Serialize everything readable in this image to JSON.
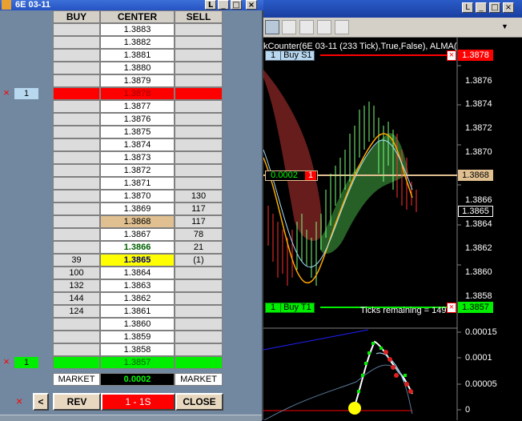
{
  "dom_window": {
    "title": "6E 03-11",
    "headers": {
      "buy": "BUY",
      "center": "CENTER",
      "sell": "SELL"
    },
    "rows": [
      {
        "buy": "",
        "price": "1.3883",
        "sell": "",
        "style": "white"
      },
      {
        "buy": "",
        "price": "1.3882",
        "sell": "",
        "style": "white"
      },
      {
        "buy": "",
        "price": "1.3881",
        "sell": "",
        "style": "white"
      },
      {
        "buy": "",
        "price": "1.3880",
        "sell": "",
        "style": "white"
      },
      {
        "buy": "",
        "price": "1.3879",
        "sell": "",
        "style": "white"
      },
      {
        "buy": "",
        "price": "1.3878",
        "sell": "",
        "style": "red",
        "left_x": "×",
        "left_qty": "1"
      },
      {
        "buy": "",
        "price": "1.3877",
        "sell": "",
        "style": "white"
      },
      {
        "buy": "",
        "price": "1.3876",
        "sell": "",
        "style": "white"
      },
      {
        "buy": "",
        "price": "1.3875",
        "sell": "",
        "style": "white"
      },
      {
        "buy": "",
        "price": "1.3874",
        "sell": "",
        "style": "white"
      },
      {
        "buy": "",
        "price": "1.3873",
        "sell": "",
        "style": "white"
      },
      {
        "buy": "",
        "price": "1.3872",
        "sell": "",
        "style": "white"
      },
      {
        "buy": "",
        "price": "1.3871",
        "sell": "",
        "style": "white"
      },
      {
        "buy": "",
        "price": "1.3870",
        "sell": "130",
        "style": "white"
      },
      {
        "buy": "",
        "price": "1.3869",
        "sell": "117",
        "style": "white"
      },
      {
        "buy": "",
        "price": "1.3868",
        "sell": "117",
        "style": "tan"
      },
      {
        "buy": "",
        "price": "1.3867",
        "sell": "78",
        "style": "white"
      },
      {
        "buy": "",
        "price": "1.3866",
        "sell": "21",
        "style": "ask"
      },
      {
        "buy": "39",
        "price": "1.3865",
        "sell": "(1)",
        "style": "last"
      },
      {
        "buy": "100",
        "price": "1.3864",
        "sell": "",
        "style": "white"
      },
      {
        "buy": "132",
        "price": "1.3863",
        "sell": "",
        "style": "white"
      },
      {
        "buy": "144",
        "price": "1.3862",
        "sell": "",
        "style": "white"
      },
      {
        "buy": "124",
        "price": "1.3861",
        "sell": "",
        "style": "white"
      },
      {
        "buy": "",
        "price": "1.3860",
        "sell": "",
        "style": "white"
      },
      {
        "buy": "",
        "price": "1.3859",
        "sell": "",
        "style": "white"
      },
      {
        "buy": "",
        "price": "1.3858",
        "sell": "",
        "style": "white"
      },
      {
        "buy": "",
        "price": "1.3857",
        "sell": "",
        "style": "green",
        "left_x": "×",
        "left_qty": "1"
      }
    ],
    "market_row": {
      "buy": "MARKET",
      "center": "0.0002",
      "sell": "MARKET"
    },
    "buttons": {
      "cancel": "×",
      "left": "<",
      "rev": "REV",
      "qty": "1 - 1S",
      "close": "CLOSE"
    }
  },
  "chart_window": {
    "indicator_label": "kCounter(6E 03-11 (233 Tick),True,False), ALMA(",
    "ticks_remaining": "Ticks remaining = 149",
    "orders": [
      {
        "label": "Buy S1",
        "qty": "1",
        "price": "1.3878"
      },
      {
        "label": "Buy T1",
        "qty": "1",
        "price": "1.3857"
      }
    ],
    "position": {
      "pnl": "0.0002",
      "qty": "1",
      "price": "1.3868"
    },
    "last_price": "1.3865",
    "y_axis": [
      "1.3876",
      "1.3874",
      "1.3872",
      "1.3870",
      "1.3866",
      "1.3864",
      "1.3862",
      "1.3860",
      "1.3858"
    ],
    "lower_axis": [
      "0.00015",
      "0.0001",
      "0.00005",
      "0"
    ]
  },
  "colors": {
    "red": "#ff0000",
    "green": "#00ee00",
    "tan": "#e0c090",
    "yellow": "#ffff00"
  }
}
